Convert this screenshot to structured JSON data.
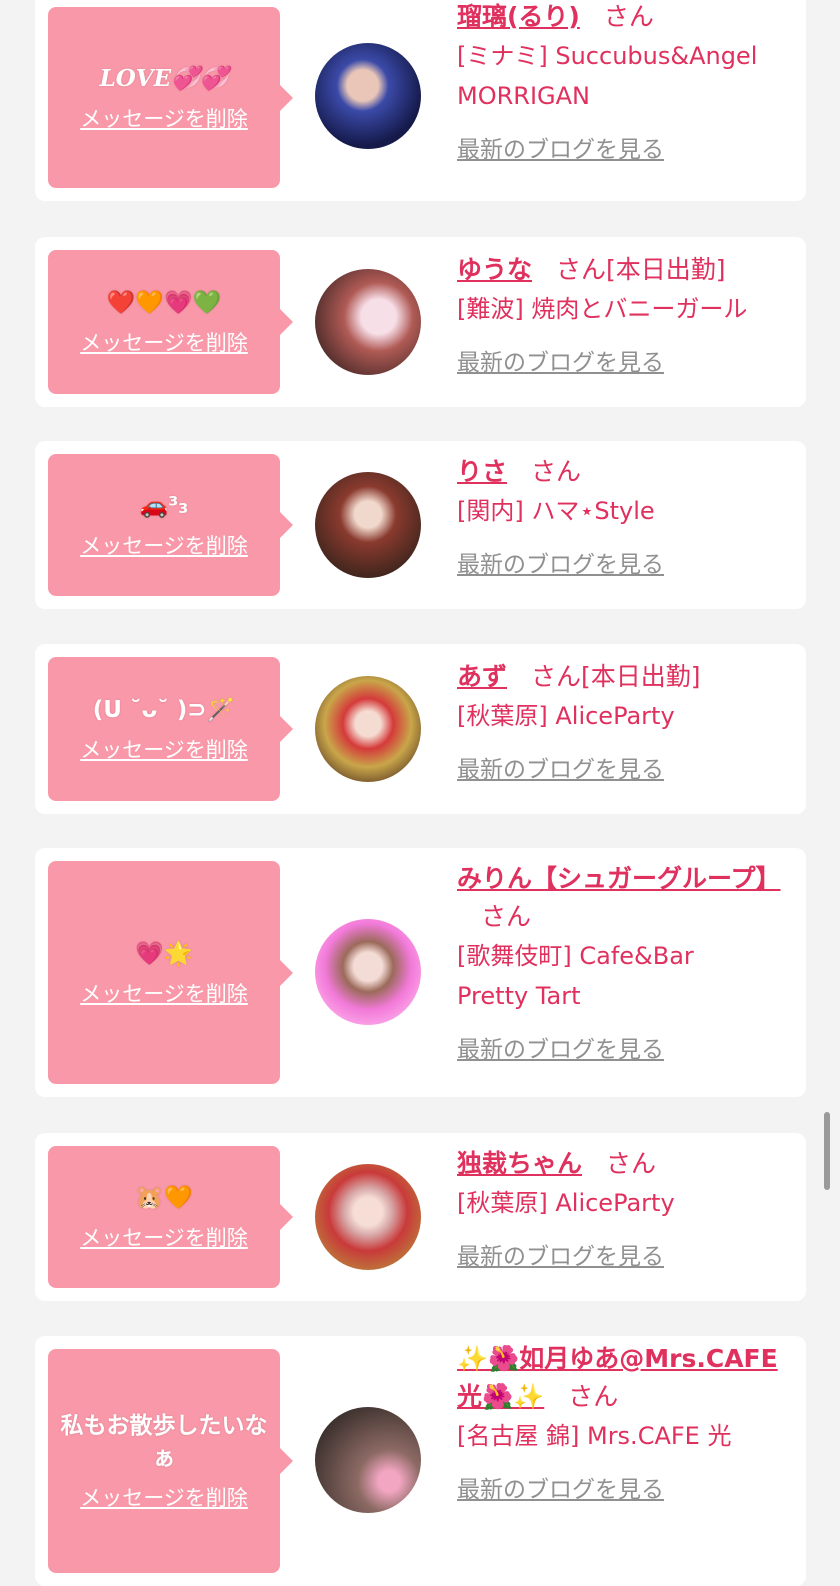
{
  "common": {
    "delete_label": "メッセージを削除",
    "blog_label": "最新のブログを見る",
    "san": "さん"
  },
  "cards": [
    {
      "message": "𝑳𝑶𝑽𝑬💞💞",
      "name": "瑠璃(るり)",
      "status": "",
      "shop": "[ミナミ] Succubus&Angel MORRIGAN"
    },
    {
      "message": "❤️🧡💗💚",
      "name": "ゆうな",
      "status": "[本日出勤]",
      "shop": "[難波] 焼肉とバニーガール"
    },
    {
      "message": "🚗³₃",
      "name": "りさ",
      "status": "",
      "shop": "[関内] ハマ⋆Style"
    },
    {
      "message": "(U ˘ᴗ˘ )⊃🪄",
      "name": "あず",
      "status": "[本日出勤]",
      "shop": "[秋葉原] AliceParty"
    },
    {
      "message": "💗🌟",
      "name": "みりん【シュガーグループ】",
      "status": "",
      "shop": "[歌舞伎町] Cafe&Bar Pretty Tart"
    },
    {
      "message": "🐹🧡",
      "name": "独裁ちゃん",
      "status": "",
      "shop": "[秋葉原] AliceParty"
    },
    {
      "message": "私もお散歩したいなぁ",
      "name": "✨🌺如月ゆあ@Mrs.CAFE光🌺✨",
      "status": "",
      "shop": "[名古屋 錦] Mrs.CAFE 光"
    }
  ]
}
